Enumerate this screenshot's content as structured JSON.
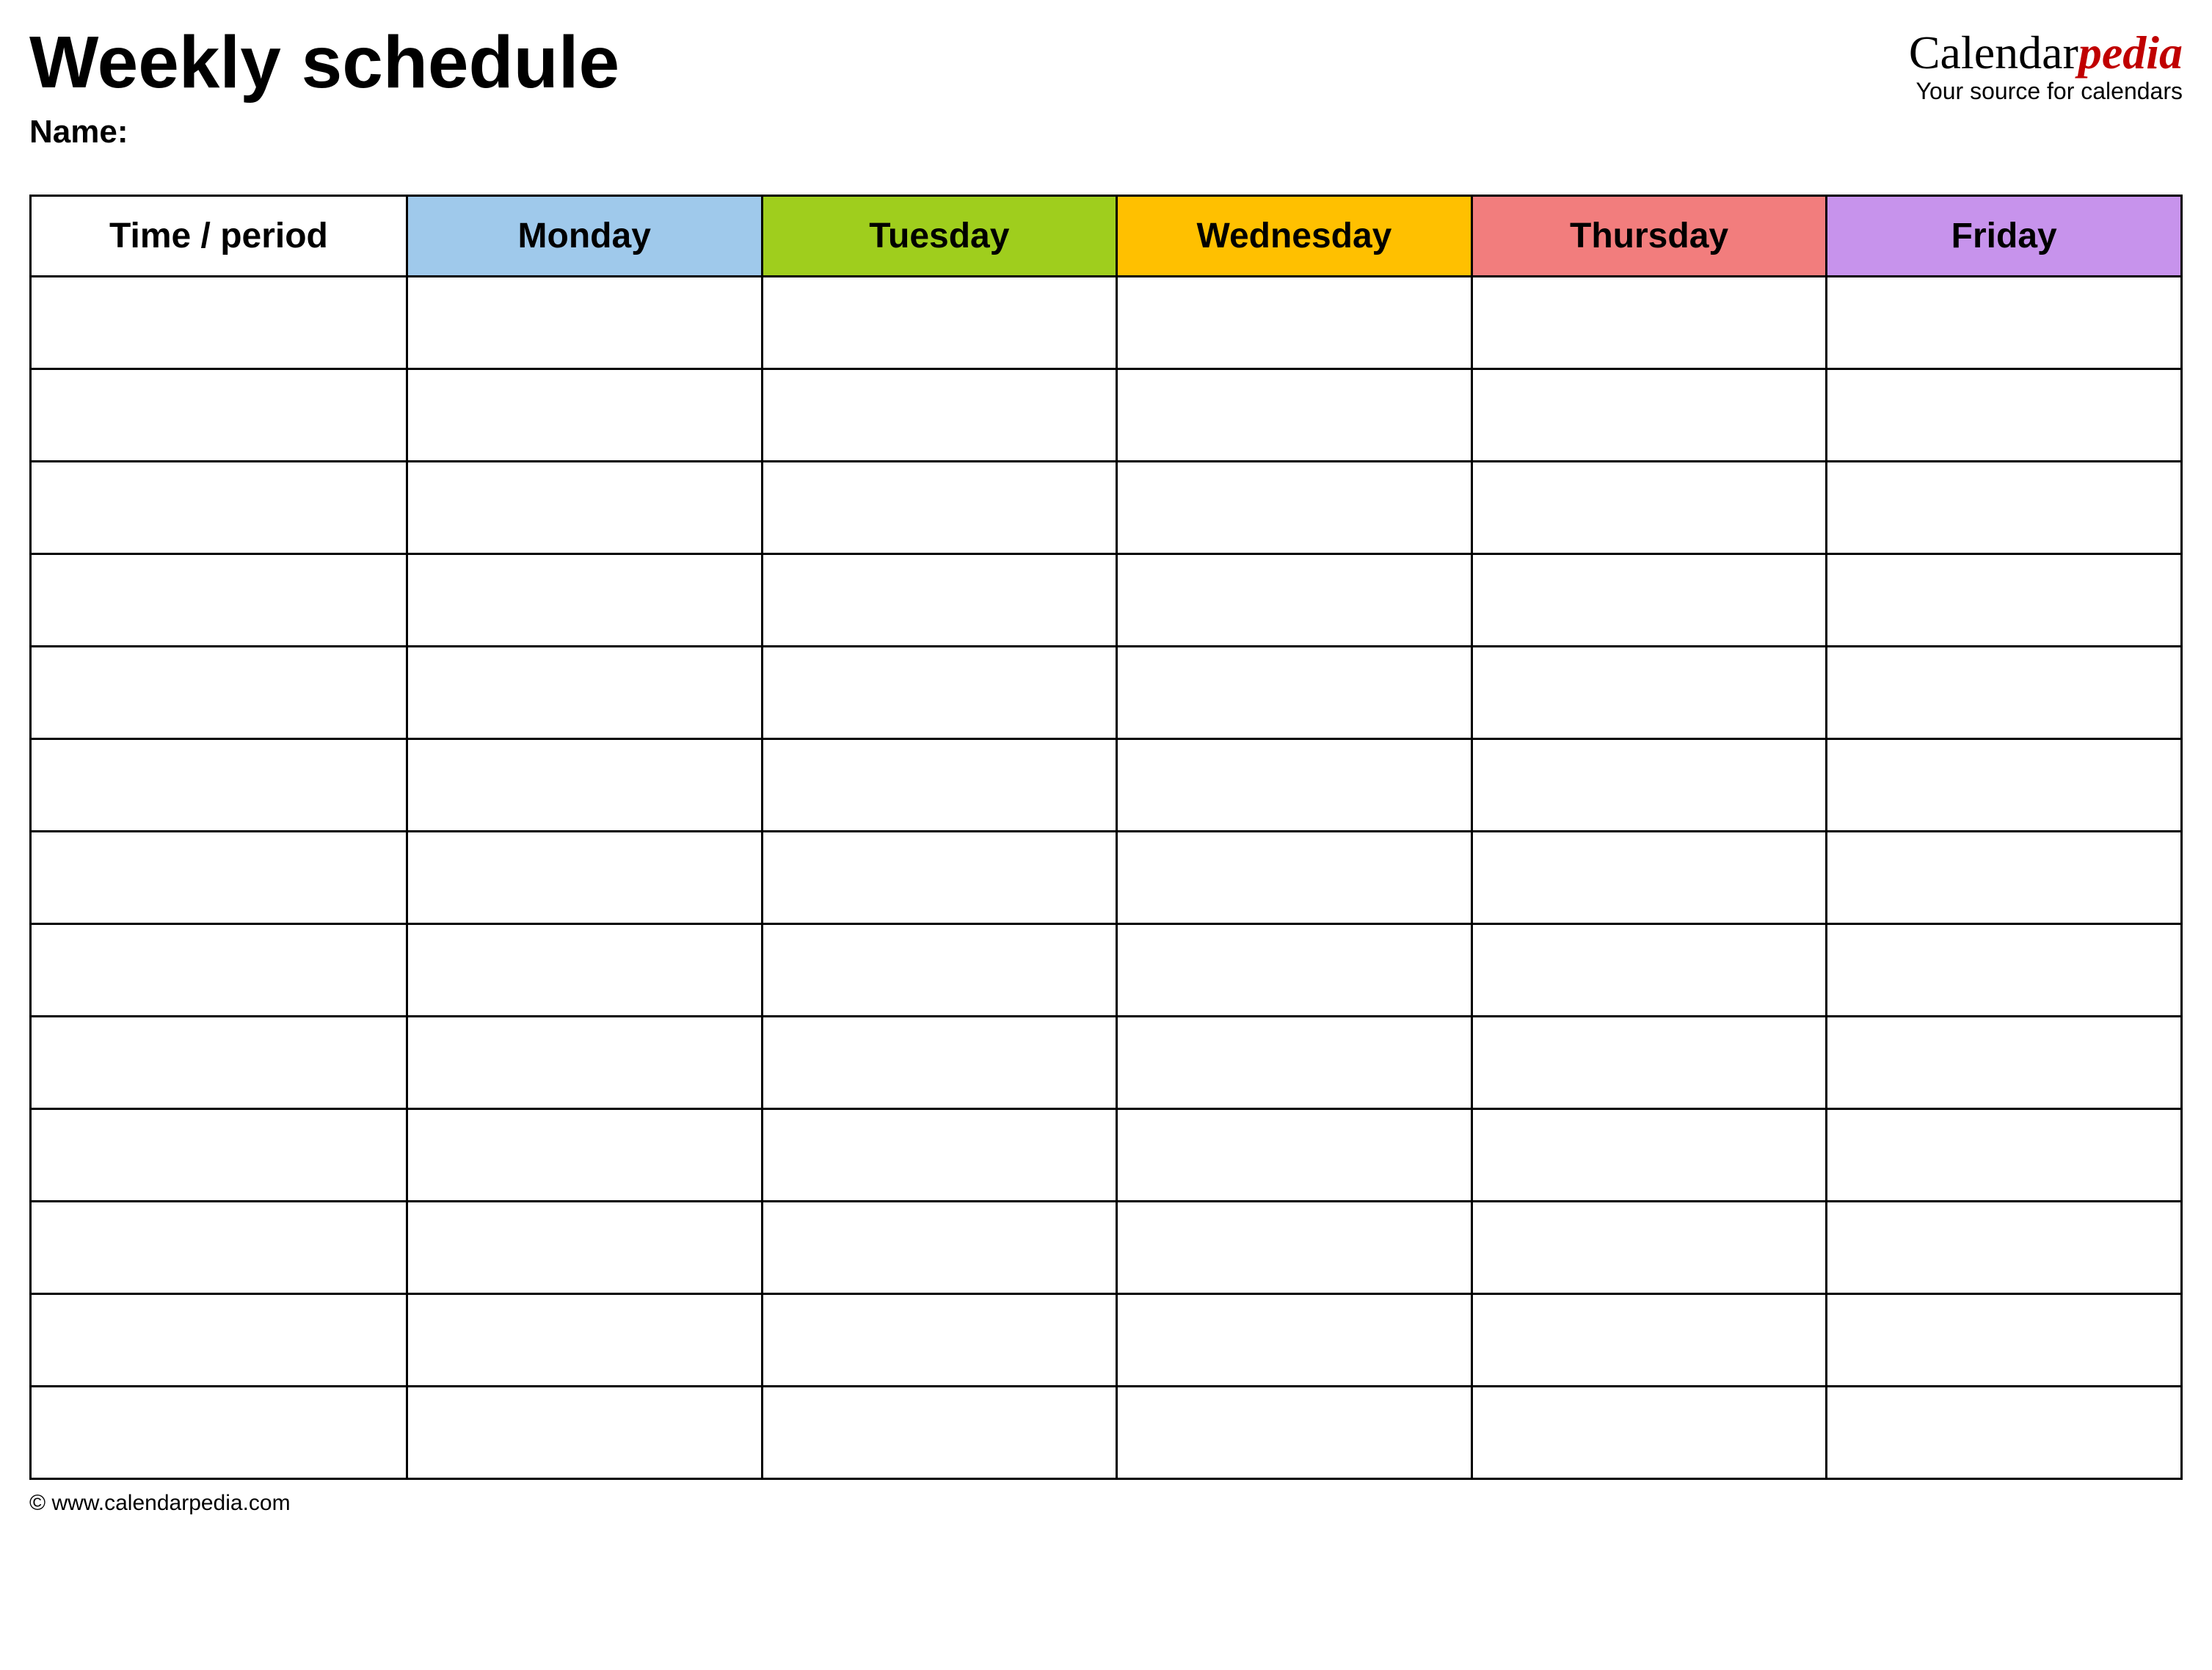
{
  "header": {
    "title": "Weekly schedule",
    "name_label": "Name:"
  },
  "brand": {
    "part1": "Calendar",
    "part2": "pedia",
    "tagline": "Your source for calendars"
  },
  "columns": {
    "time": "Time / period",
    "mon": "Monday",
    "tue": "Tuesday",
    "wed": "Wednesday",
    "thu": "Thursday",
    "fri": "Friday"
  },
  "row_count": 13,
  "footer": "© www.calendarpedia.com",
  "colors": {
    "mon": "#9fc9eb",
    "tue": "#9fce1d",
    "wed": "#ffc000",
    "thu": "#f27d7d",
    "fri": "#c793ec",
    "brand_accent": "#c00000"
  }
}
